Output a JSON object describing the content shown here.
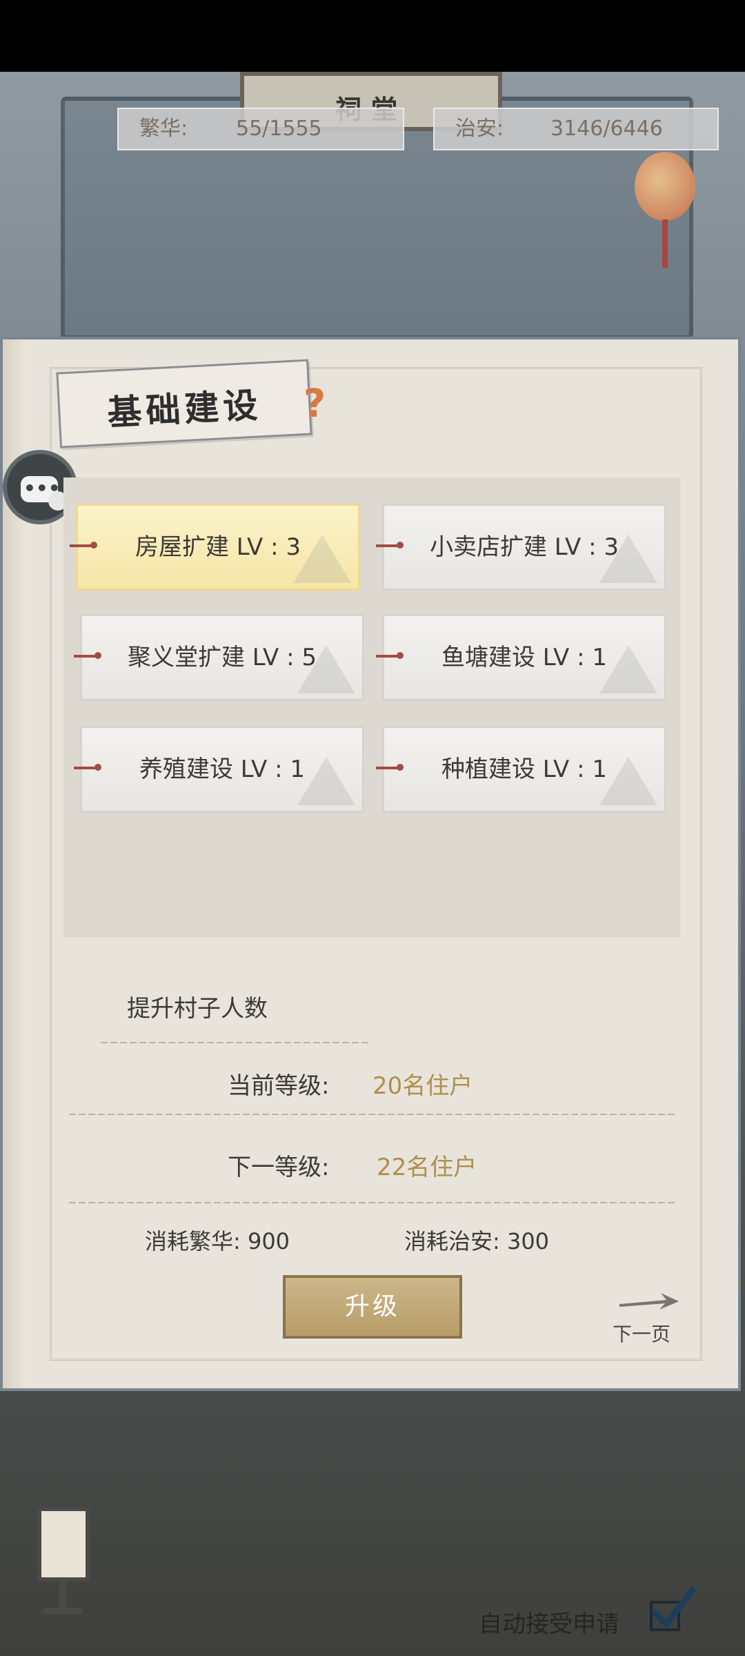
{
  "stats": {
    "prosperity_label": "繁华:",
    "prosperity_value": "55/1555",
    "security_label": "治安:",
    "security_value": "3146/6446"
  },
  "shrine_sign": "祠堂",
  "panel": {
    "title": "基础建设",
    "help_glyph": "?",
    "buildings": [
      {
        "label": "房屋扩建 LV : 3",
        "selected": true
      },
      {
        "label": "小卖店扩建 LV : 3",
        "selected": false
      },
      {
        "label": "聚义堂扩建 LV : 5",
        "selected": false
      },
      {
        "label": "鱼塘建设 LV : 1",
        "selected": false
      },
      {
        "label": "养殖建设 LV : 1",
        "selected": false
      },
      {
        "label": "种植建设 LV : 1",
        "selected": false
      }
    ]
  },
  "detail": {
    "title": "提升村子人数",
    "current_label": "当前等级:",
    "current_value": "20名住户",
    "next_label": "下一等级:",
    "next_value": "22名住户",
    "cost_prosperity": "消耗繁华: 900",
    "cost_security": "消耗治安: 300",
    "upgrade_label": "升级",
    "next_page_label": "下一页"
  },
  "footer": {
    "auto_accept_label": "自动接受申请",
    "auto_accept_checked": true
  },
  "colors": {
    "value_gold": "#b08f4a",
    "selected_bg": "#f5e6a7",
    "pin_red": "#a34c45",
    "help_orange": "#d97842"
  },
  "icons": {
    "chat": "chat-icon",
    "help": "help-icon",
    "next_arrow": "arrow-right-icon",
    "lamp": "lamp-icon",
    "check": "check-icon"
  }
}
